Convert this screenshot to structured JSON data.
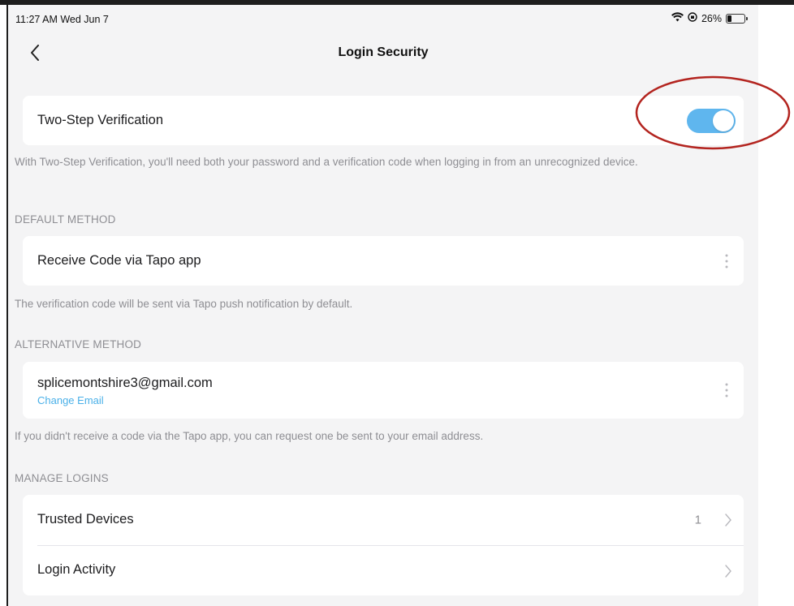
{
  "status_bar": {
    "time": "11:27 AM  Wed Jun 7",
    "battery": "26%"
  },
  "nav": {
    "title": "Login Security"
  },
  "two_step": {
    "label": "Two-Step Verification",
    "enabled": true,
    "description": "With Two-Step Verification, you'll need both your password and a verification code when logging in from an unrecognized device."
  },
  "default_method": {
    "header": "DEFAULT METHOD",
    "label": "Receive Code via Tapo app",
    "note": "The verification code will be sent via Tapo push notification by default."
  },
  "alternative_method": {
    "header": "ALTERNATIVE METHOD",
    "email": "splicemontshire3@gmail.com",
    "change_link": "Change Email",
    "note": "If you didn't receive a code via the Tapo app, you can request one be sent to your email address."
  },
  "manage_logins": {
    "header": "MANAGE LOGINS",
    "trusted_devices": {
      "label": "Trusted Devices",
      "count": "1"
    },
    "login_activity": {
      "label": "Login Activity"
    }
  },
  "colors": {
    "accent": "#5fb6ee",
    "link": "#4ab0e8",
    "annotation": "#b3241f"
  }
}
